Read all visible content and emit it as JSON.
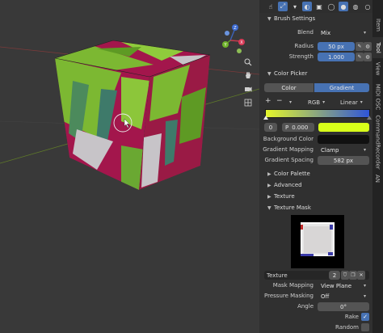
{
  "colors": {
    "accent": "#4772b3",
    "viewport_bg": "#393939",
    "panel_bg": "#303030",
    "cube_green": "#7cb832",
    "cube_magenta": "#a3164c"
  },
  "viewport": {
    "nav_gizmo": {
      "z_label": "Z",
      "y_label": "Y",
      "x_label": "X"
    },
    "tools": [
      "zoom-icon",
      "hand-icon",
      "camera-icon",
      "grid-icon"
    ]
  },
  "topstrip": {
    "icons": [
      "selectability-icon",
      "gizmo-icon",
      "overlays-icon",
      "xray-icon",
      "wireframe-shading-icon",
      "solid-shading-icon",
      "material-shading-icon",
      "rendered-shading-icon"
    ]
  },
  "brush_settings": {
    "header": "Brush Settings",
    "blend": {
      "label": "Blend",
      "value": "Mix"
    },
    "radius": {
      "label": "Radius",
      "value": "50 px"
    },
    "strength": {
      "label": "Strength",
      "value": "1.000"
    }
  },
  "color_picker": {
    "header": "Color Picker",
    "tab_color": "Color",
    "tab_gradient": "Gradient",
    "add_label": "+",
    "remove_label": "−",
    "color_mode": "RGB",
    "interpolation": "Linear",
    "stop_index": "0",
    "pos_prefix": "P",
    "pos_value": "0.000",
    "gradient_left": "#e5f72a",
    "gradient_right": "#2f55d8",
    "stop_color": "#d8ff1a",
    "background_color": {
      "label": "Background Color",
      "value": "#111111"
    },
    "gradient_mapping": {
      "label": "Gradient Mapping",
      "value": "Clamp"
    },
    "gradient_spacing": {
      "label": "Gradient Spacing",
      "value": "582 px"
    }
  },
  "sections": {
    "color_palette": "Color Palette",
    "advanced": "Advanced",
    "texture": "Texture",
    "texture_mask": "Texture Mask"
  },
  "texture_mask": {
    "slot_label": "Texture",
    "user_count": "2",
    "mask_mapping": {
      "label": "Mask Mapping",
      "value": "View Plane"
    },
    "pressure_masking": {
      "label": "Pressure Masking",
      "value": "Off"
    },
    "angle": {
      "label": "Angle",
      "value": "0°"
    },
    "rake": {
      "label": "Rake",
      "checked": true
    },
    "random": {
      "label": "Random",
      "checked": false
    }
  },
  "tabs": [
    {
      "label": "Item",
      "active": false
    },
    {
      "label": "Tool",
      "active": true
    },
    {
      "label": "View",
      "active": false
    },
    {
      "label": "MIDI OSC",
      "active": false
    },
    {
      "label": "CommandRecorder",
      "active": false
    },
    {
      "label": "AN",
      "active": false
    }
  ]
}
